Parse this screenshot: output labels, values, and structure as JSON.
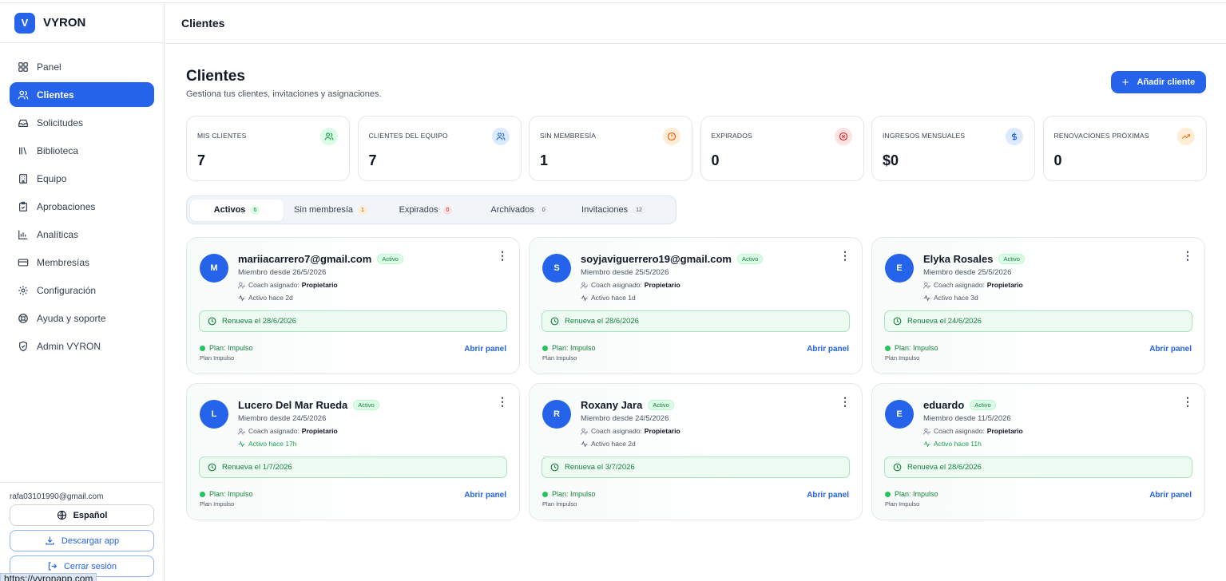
{
  "brand": {
    "logo_letter": "V",
    "name": "VYRON"
  },
  "sidebar": {
    "items": [
      {
        "label": "Panel",
        "icon": "grid-icon"
      },
      {
        "label": "Clientes",
        "icon": "users-icon"
      },
      {
        "label": "Solicitudes",
        "icon": "inbox-icon"
      },
      {
        "label": "Biblioteca",
        "icon": "library-icon"
      },
      {
        "label": "Equipo",
        "icon": "building-icon"
      },
      {
        "label": "Aprobaciones",
        "icon": "clipboard-icon"
      },
      {
        "label": "Analíticas",
        "icon": "bar-chart-icon"
      },
      {
        "label": "Membresías",
        "icon": "card-icon"
      },
      {
        "label": "Configuración",
        "icon": "gear-icon"
      },
      {
        "label": "Ayuda y soporte",
        "icon": "lifebuoy-icon"
      },
      {
        "label": "Admin VYRON",
        "icon": "shield-icon"
      }
    ],
    "user_email": "rafa03101990@gmail.com",
    "language": "Español",
    "download": "Descargar app",
    "logout": "Cerrar sesión",
    "url_tooltip": "https://vyronapp.com"
  },
  "header": {
    "title": "Clientes"
  },
  "page": {
    "title": "Clientes",
    "subtitle": "Gestiona tus clientes, invitaciones y asignaciones.",
    "add_button": "Añadir cliente"
  },
  "stats": [
    {
      "label": "MIS CLIENTES",
      "value": "7",
      "color": "#16a34a",
      "bg": "#dcfce7"
    },
    {
      "label": "CLIENTES DEL EQUIPO",
      "value": "7",
      "color": "#2563eb",
      "bg": "#dbeafe"
    },
    {
      "label": "SIN MEMBRESÍA",
      "value": "1",
      "color": "#ea580c",
      "bg": "#ffedd5"
    },
    {
      "label": "EXPIRADOS",
      "value": "0",
      "color": "#dc2626",
      "bg": "#fee2e2"
    },
    {
      "label": "INGRESOS MENSUALES",
      "value": "$0",
      "color": "#2563eb",
      "bg": "#dbeafe"
    },
    {
      "label": "RENOVACIONES PRÓXIMAS",
      "value": "0",
      "color": "#f97316",
      "bg": "#ffedd5"
    }
  ],
  "tabs": [
    {
      "label": "Activos",
      "count": "6"
    },
    {
      "label": "Sin membresía",
      "count": "1"
    },
    {
      "label": "Expirados",
      "count": "0"
    },
    {
      "label": "Archivados",
      "count": "0"
    },
    {
      "label": "Invitaciones",
      "count": "12"
    }
  ],
  "clients": [
    {
      "initial": "M",
      "name": "mariiacarrero7@gmail.com",
      "status": "Activo",
      "since": "Miembro desde 26/5/2026",
      "coach_label": "Coach asignado:",
      "coach": "Propietario",
      "activity": "Activo hace 2d",
      "renew": "Renueva el 28/6/2026",
      "plan": "Plan: Impulso",
      "plan_sub": "Plan Impulso",
      "open": "Abrir panel"
    },
    {
      "initial": "S",
      "name": "soyjaviguerrero19@gmail.com",
      "status": "Activo",
      "since": "Miembro desde 25/5/2026",
      "coach_label": "Coach asignado:",
      "coach": "Propietario",
      "activity": "Activo hace 1d",
      "renew": "Renueva el 28/6/2026",
      "plan": "Plan: Impulso",
      "plan_sub": "Plan Impulso",
      "open": "Abrir panel"
    },
    {
      "initial": "E",
      "name": "Elyka Rosales",
      "status": "Activo",
      "since": "Miembro desde 25/5/2026",
      "coach_label": "Coach asignado:",
      "coach": "Propietario",
      "activity": "Activo hace 3d",
      "renew": "Renueva el 24/6/2026",
      "plan": "Plan: Impulso",
      "plan_sub": "Plan Impulso",
      "open": "Abrir panel"
    },
    {
      "initial": "L",
      "name": "Lucero Del Mar Rueda",
      "status": "Activo",
      "since": "Miembro desde 24/5/2026",
      "coach_label": "Coach asignado:",
      "coach": "Propietario",
      "activity": "Activo hace 17h",
      "renew": "Renueva el 1/7/2026",
      "plan": "Plan: Impulso",
      "plan_sub": "Plan Impulso",
      "open": "Abrir panel"
    },
    {
      "initial": "R",
      "name": "Roxany Jara",
      "status": "Activo",
      "since": "Miembro desde 24/5/2026",
      "coach_label": "Coach asignado:",
      "coach": "Propietario",
      "activity": "Activo hace 2d",
      "renew": "Renueva el 3/7/2026",
      "plan": "Plan: Impulso",
      "plan_sub": "Plan Impulso",
      "open": "Abrir panel"
    },
    {
      "initial": "E",
      "name": "eduardo",
      "status": "Activo",
      "since": "Miembro desde 11/5/2026",
      "coach_label": "Coach asignado:",
      "coach": "Propietario",
      "activity": "Activo hace 11h",
      "renew": "Renueva el 28/6/2026",
      "plan": "Plan: Impulso",
      "plan_sub": "Plan Impulso",
      "open": "Abrir panel"
    }
  ],
  "colors": {
    "accent": "#2563eb",
    "success": "#16a34a"
  }
}
